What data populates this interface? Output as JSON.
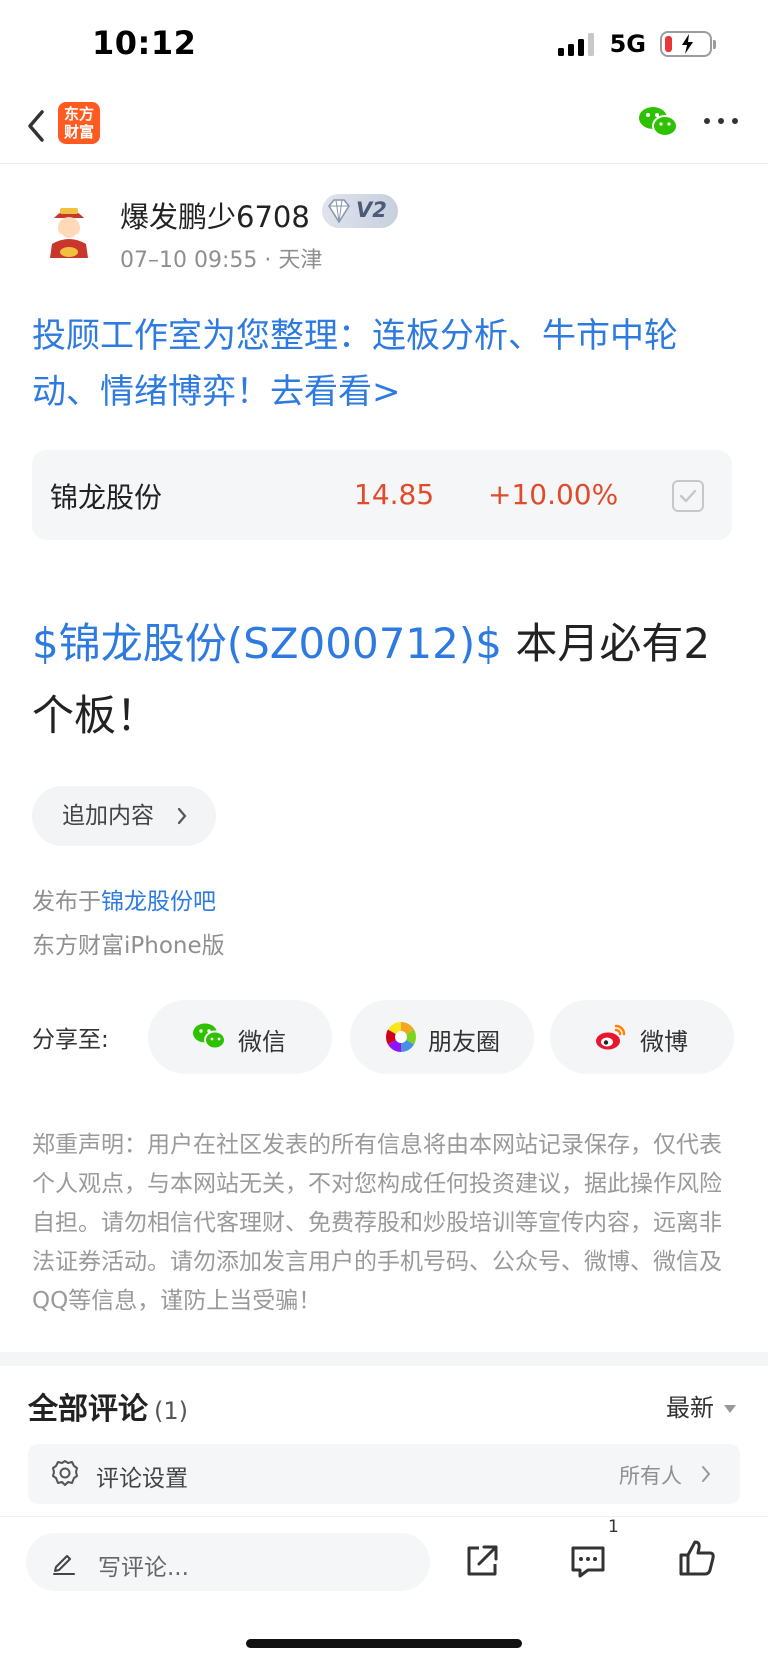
{
  "status_bar": {
    "time": "10:12",
    "network": "5G"
  },
  "nav": {
    "logo_line1": "东方",
    "logo_line2": "财富"
  },
  "author": {
    "name": "爆发鹏少6708",
    "vip_level": "V2",
    "meta": "07–10 09:55 · 天津"
  },
  "promo_text": "投顾工作室为您整理：连板分析、牛市中轮动、情绪博弈！去看看>",
  "stock": {
    "name": "锦龙股份",
    "price": "14.85",
    "change": "+10.00%"
  },
  "post": {
    "cashtag": "$锦龙股份(SZ000712)$",
    "text": "  本月必有2个板！"
  },
  "append_button": "追加内容",
  "published": {
    "prefix": "发布于",
    "forum": "锦龙股份吧",
    "platform": "东方财富iPhone版"
  },
  "share": {
    "label": "分享至:",
    "wechat": "微信",
    "moments": "朋友圈",
    "weibo": "微博"
  },
  "disclaimer": "郑重声明：用户在社区发表的所有信息将由本网站记录保存，仅代表个人观点，与本网站无关，不对您构成任何投资建议，据此操作风险自担。请勿相信代客理财、免费荐股和炒股培训等宣传内容，远离非法证券活动。请勿添加发言用户的手机号码、公众号、微博、微信及QQ等信息，谨防上当受骗！",
  "comments": {
    "title": "全部评论",
    "count": "(1)",
    "sort": "最新",
    "settings_label": "评论设置",
    "settings_value": "所有人"
  },
  "bottom_bar": {
    "placeholder": "写评论...",
    "comment_badge": "1"
  },
  "colors": {
    "link_blue": "#2d7ae0",
    "up_red": "#e24a2c",
    "brand_orange": "#ff5a1f",
    "wechat_green": "#2dc100"
  }
}
